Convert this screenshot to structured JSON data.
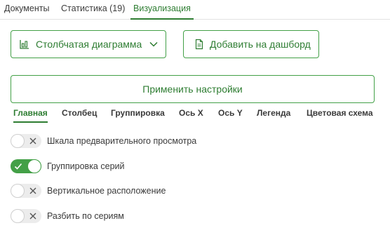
{
  "tabs": {
    "documents": "Документы",
    "statistics": "Статистика (19)",
    "visualization": "Визуализация"
  },
  "toolbar": {
    "chart_type_label": "Столбчатая диаграмма",
    "add_dashboard_label": "Добавить на дашборд",
    "apply_label": "Применить настройки"
  },
  "subtabs": {
    "main": "Главная",
    "column": "Столбец",
    "grouping": "Группировка",
    "axis_x": "Ось X",
    "axis_y": "Ось Y",
    "legend": "Легенда",
    "color_scheme": "Цветовая схема"
  },
  "toggles": {
    "preview_scale": {
      "label": "Шкала предварительного просмотра",
      "checked": false
    },
    "series_grouping": {
      "label": "Группировка серий",
      "checked": true
    },
    "vertical_layout": {
      "label": "Вертикальное расположение",
      "checked": false
    },
    "split_by_series": {
      "label": "Разбить по сериям",
      "checked": false
    }
  },
  "colors": {
    "accent": "#43a047",
    "accent_text": "#2e7d32"
  },
  "icons": {
    "chart_type": "bar-chart-icon",
    "dropdown": "chevron-down-icon",
    "dashboard": "document-icon",
    "toggle_off": "close-icon",
    "toggle_on": "check-icon"
  }
}
